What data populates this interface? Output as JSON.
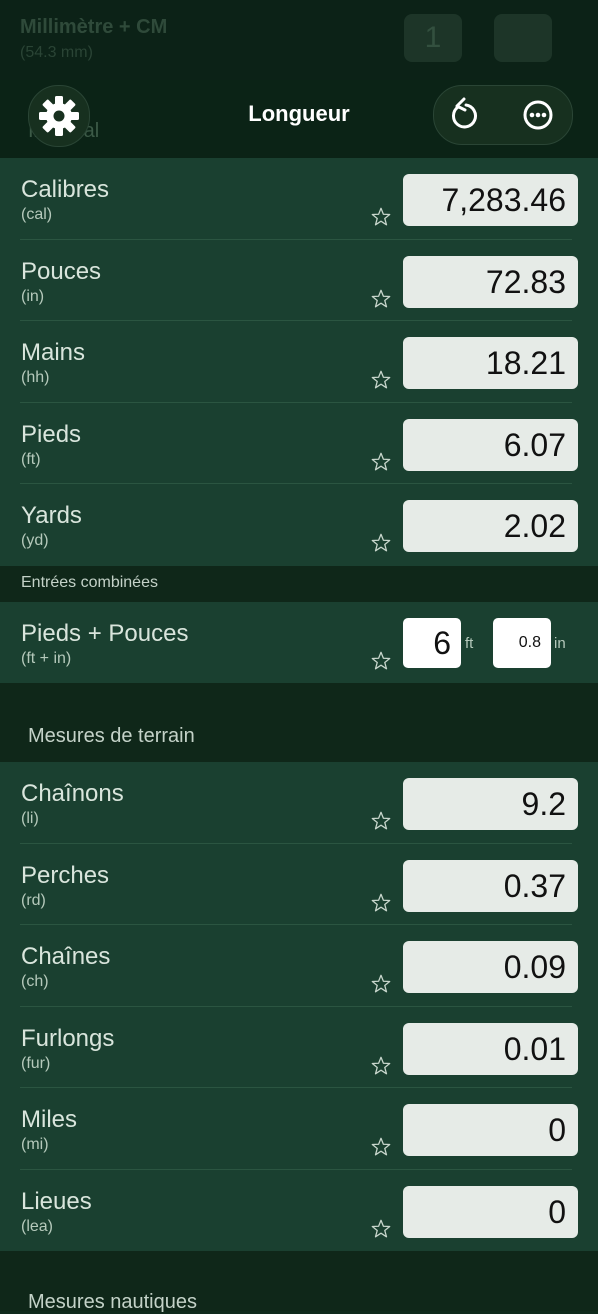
{
  "ghost_header": {
    "title": "Millimètre + CM",
    "subtitle": "(54.3 mm)",
    "badge": "1"
  },
  "toolbar": {
    "title": "Longueur",
    "ghost_section": "Impérial",
    "settings_icon": "gear-icon",
    "undo_icon": "undo-icon",
    "more_icon": "more-icon"
  },
  "imperial": [
    {
      "name": "Calibres",
      "abbr": "(cal)",
      "value": "7,283.46"
    },
    {
      "name": "Pouces",
      "abbr": "(in)",
      "value": "72.83"
    },
    {
      "name": "Mains",
      "abbr": "(hh)",
      "value": "18.21"
    },
    {
      "name": "Pieds",
      "abbr": "(ft)",
      "value": "6.07"
    },
    {
      "name": "Yards",
      "abbr": "(yd)",
      "value": "2.02"
    }
  ],
  "combined": {
    "header": "Entrées combinées",
    "name": "Pieds + Pouces",
    "abbr": "(ft + in)",
    "feet": "6",
    "feet_unit": "ft",
    "inches": "0.8",
    "inches_unit": "in"
  },
  "terrain": {
    "header": "Mesures de terrain",
    "items": [
      {
        "name": "Chaînons",
        "abbr": "(li)",
        "value": "9.2"
      },
      {
        "name": "Perches",
        "abbr": "(rd)",
        "value": "0.37"
      },
      {
        "name": "Chaînes",
        "abbr": "(ch)",
        "value": "0.09"
      },
      {
        "name": "Furlongs",
        "abbr": "(fur)",
        "value": "0.01"
      },
      {
        "name": "Miles",
        "abbr": "(mi)",
        "value": "0"
      },
      {
        "name": "Lieues",
        "abbr": "(lea)",
        "value": "0"
      }
    ]
  },
  "bottom_header": "Mesures nautiques",
  "colors": {
    "accent": "#1a4030",
    "field": "#e6ebe7"
  }
}
